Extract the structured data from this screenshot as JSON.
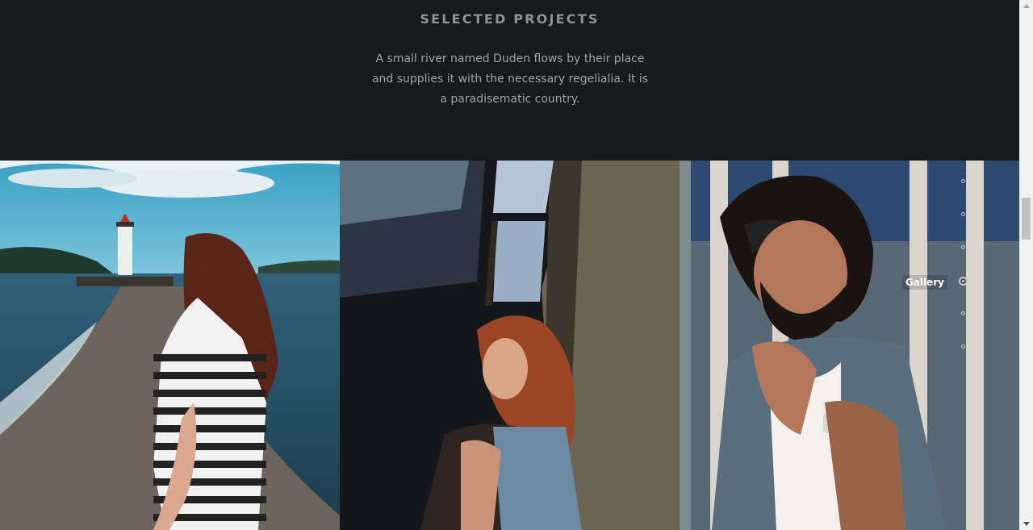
{
  "section": {
    "heading": "SELECTED PROJECTS",
    "lead": "A small river named Duden flows by their place and supplies it with the necessary regelialia. It is a paradisematic country."
  },
  "gallery": {
    "items": [
      {
        "subject": "woman-lighthouse-photo"
      },
      {
        "subject": "woman-wall-photo"
      },
      {
        "subject": "man-bandana-photo"
      }
    ]
  },
  "dot_nav": {
    "active_label": "Gallery",
    "dot_count": 6
  },
  "colors": {
    "background": "#18191b",
    "heading": "#8f9296",
    "text": "#9fa2a6"
  }
}
